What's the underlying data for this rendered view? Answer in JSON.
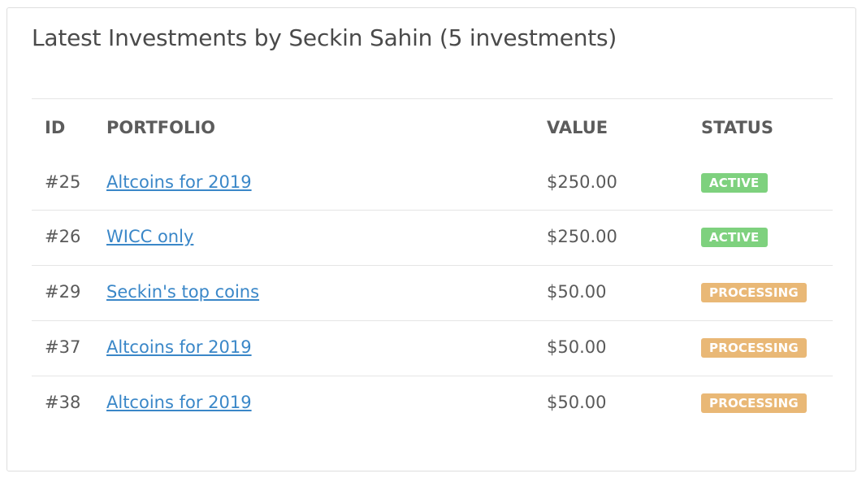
{
  "panel": {
    "title": "Latest Investments by Seckin Sahin (5 investments)"
  },
  "table": {
    "headers": {
      "id": "ID",
      "portfolio": "PORTFOLIO",
      "value": "VALUE",
      "status": "STATUS"
    },
    "rows": [
      {
        "id": "#25",
        "portfolio": "Altcoins for 2019",
        "value": "$250.00",
        "status": "ACTIVE",
        "status_color": "#7ed17e"
      },
      {
        "id": "#26",
        "portfolio": "WICC only",
        "value": "$250.00",
        "status": "ACTIVE",
        "status_color": "#7ed17e"
      },
      {
        "id": "#29",
        "portfolio": "Seckin's top coins",
        "value": "$50.00",
        "status": "PROCESSING",
        "status_color": "#e9b876"
      },
      {
        "id": "#37",
        "portfolio": "Altcoins for 2019",
        "value": "$50.00",
        "status": "PROCESSING",
        "status_color": "#e9b876"
      },
      {
        "id": "#38",
        "portfolio": "Altcoins for 2019",
        "value": "$50.00",
        "status": "PROCESSING",
        "status_color": "#e9b876"
      }
    ]
  },
  "colors": {
    "link": "#3a87c8",
    "active": "#7ed17e",
    "processing": "#e9b876",
    "text": "#5a5a5a",
    "border": "#e5e5e5"
  }
}
